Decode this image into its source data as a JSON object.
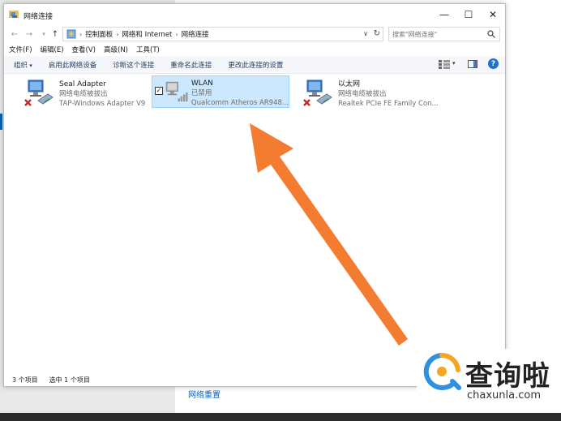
{
  "background": {
    "link_text": "网络重置"
  },
  "window": {
    "title": "网络连接",
    "controls": {
      "minimize": "—",
      "maximize": "☐",
      "close": "✕"
    },
    "breadcrumb": [
      "控制面板",
      "网络和 Internet",
      "网络连接"
    ],
    "search_placeholder": "搜索\"网络连接\"",
    "menu": [
      "文件(F)",
      "编辑(E)",
      "查看(V)",
      "高级(N)",
      "工具(T)"
    ],
    "commands": {
      "organize": "组织",
      "enable": "启用此网络设备",
      "diagnose": "诊断这个连接",
      "rename": "重命名此连接",
      "change_settings": "更改此连接的设置"
    },
    "help": "?",
    "items": [
      {
        "name": "Seal Adapter",
        "status": "网络电缆被拔出",
        "device": "TAP-Windows Adapter V9",
        "icon": "ethernet-disconnected-icon"
      },
      {
        "name": "WLAN",
        "status": "已禁用",
        "device": "Qualcomm Atheros AR948...",
        "icon": "wifi-disabled-icon",
        "selected": true
      },
      {
        "name": "以太网",
        "status": "网络电缆被拔出",
        "device": "Realtek PCIe FE Family Con...",
        "icon": "ethernet-disconnected-icon"
      }
    ],
    "status_bar": {
      "count": "3 个项目",
      "selected": "选中 1 个项目"
    }
  },
  "watermark": {
    "name": "查询啦",
    "domain": "chaxunla.com"
  },
  "colors": {
    "selection": "#cce8ff",
    "arrow": "#f47c30",
    "accent": "#1e73c9"
  }
}
